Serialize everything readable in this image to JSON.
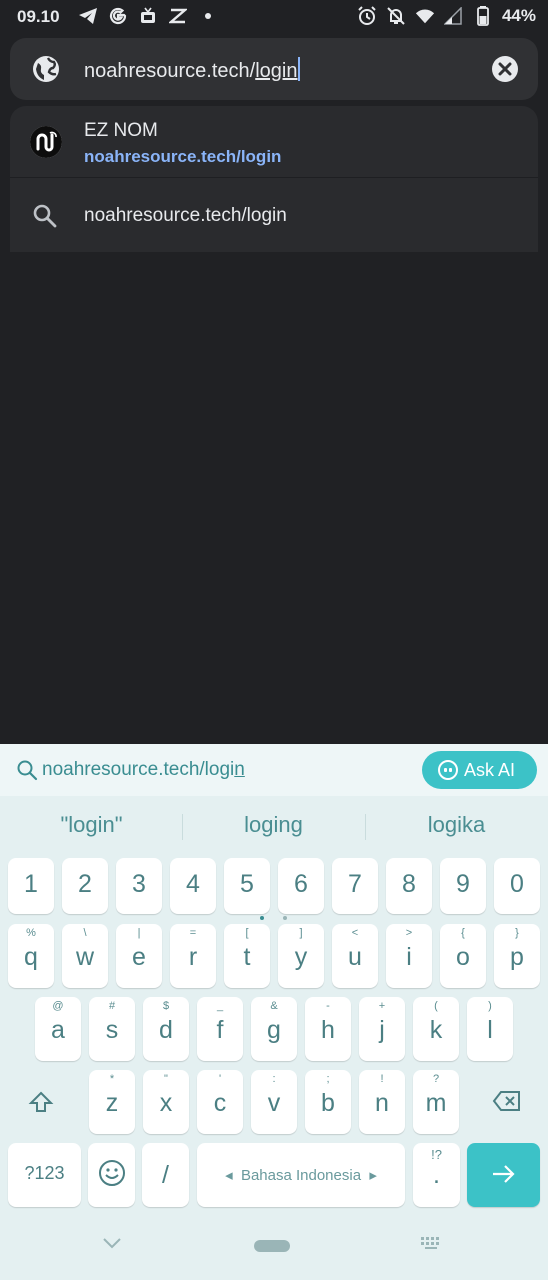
{
  "status_bar": {
    "time": "09.10",
    "battery": "44%"
  },
  "omnibox": {
    "text_prefix": "noahresource.tech/",
    "text_underlined": "login"
  },
  "suggestions": [
    {
      "title": "EZ NOM",
      "url": "noahresource.tech/login"
    },
    {
      "text": "noahresource.tech/login"
    }
  ],
  "keyboard": {
    "search_query_prefix": "noahresource.tech/logi",
    "search_query_underlined": "n",
    "ask_ai": "Ask AI",
    "predictions": [
      "\"login\"",
      "loging",
      "logika"
    ],
    "number_row": [
      "1",
      "2",
      "3",
      "4",
      "5",
      "6",
      "7",
      "8",
      "9",
      "0"
    ],
    "row1": [
      {
        "k": "q",
        "h": "%"
      },
      {
        "k": "w",
        "h": "\\"
      },
      {
        "k": "e",
        "h": "|"
      },
      {
        "k": "r",
        "h": "="
      },
      {
        "k": "t",
        "h": "["
      },
      {
        "k": "y",
        "h": "]"
      },
      {
        "k": "u",
        "h": "<"
      },
      {
        "k": "i",
        "h": ">"
      },
      {
        "k": "o",
        "h": "{"
      },
      {
        "k": "p",
        "h": "}"
      }
    ],
    "row2": [
      {
        "k": "a",
        "h": "@"
      },
      {
        "k": "s",
        "h": "#"
      },
      {
        "k": "d",
        "h": "$"
      },
      {
        "k": "f",
        "h": "_"
      },
      {
        "k": "g",
        "h": "&"
      },
      {
        "k": "h",
        "h": "-"
      },
      {
        "k": "j",
        "h": "+"
      },
      {
        "k": "k",
        "h": "("
      },
      {
        "k": "l",
        "h": ")"
      }
    ],
    "row3": [
      {
        "k": "z",
        "h": "*"
      },
      {
        "k": "x",
        "h": "\""
      },
      {
        "k": "c",
        "h": "'"
      },
      {
        "k": "v",
        "h": ":"
      },
      {
        "k": "b",
        "h": ";"
      },
      {
        "k": "n",
        "h": "!"
      },
      {
        "k": "m",
        "h": "?"
      }
    ],
    "symbols_key": "?123",
    "slash_key": "/",
    "space_label": "Bahasa Indonesia",
    "period_key": ".",
    "period_hint": "!?"
  },
  "colors": {
    "accent": "#3cc2c7",
    "link": "#8ab4f8",
    "background": "#202124"
  }
}
